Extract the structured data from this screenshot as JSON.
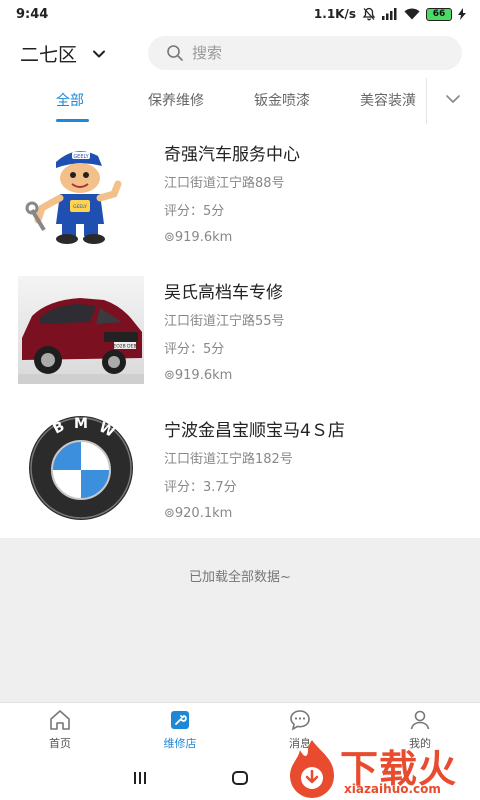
{
  "status_bar": {
    "time": "9:44",
    "network_speed": "1.1K/s",
    "battery": "66",
    "icons": [
      "mute-icon",
      "signal-icon",
      "wifi-icon",
      "battery-icon",
      "charging-icon"
    ]
  },
  "header": {
    "district": "二七区",
    "search_placeholder": "搜索"
  },
  "tabs": [
    {
      "label": "全部",
      "active": true
    },
    {
      "label": "保养维修",
      "active": false
    },
    {
      "label": "钣金喷漆",
      "active": false
    },
    {
      "label": "美容装潢",
      "active": false
    }
  ],
  "shops": [
    {
      "name": "奇强汽车服务中心",
      "address": "江口街道江宁路88号",
      "score": "评分：5分",
      "distance": "⊚919.6km",
      "thumb": "mechanic-mascot",
      "mascot_cap": "GEELY",
      "mascot_badge": "GEELY"
    },
    {
      "name": "吴氏高档车专修",
      "address": "江口街道江宁路55号",
      "score": "评分：5分",
      "distance": "⊚919.6km",
      "thumb": "red-bmw-suv",
      "plate": "EO2B DEB"
    },
    {
      "name": "宁波金昌宝顺宝马4Ｓ店",
      "address": "江口街道江宁路182号",
      "score": "评分：3.7分",
      "distance": "⊚920.1km",
      "thumb": "bmw-logo",
      "logo_letters": [
        "B",
        "M",
        "W"
      ]
    }
  ],
  "list_footer": "已加载全部数据~",
  "bottom_nav": [
    {
      "label": "首页",
      "icon": "home-icon",
      "active": false
    },
    {
      "label": "维修店",
      "icon": "shop-icon",
      "active": true
    },
    {
      "label": "消息",
      "icon": "chat-icon",
      "active": false
    },
    {
      "label": "我的",
      "icon": "user-icon",
      "active": false
    }
  ],
  "watermark": {
    "title": "下载火",
    "subtitle": "xiazaihuo.com"
  },
  "colors": {
    "accent": "#1e88d6",
    "watermark": "#e84b2e",
    "footer_bg": "#efefef"
  }
}
